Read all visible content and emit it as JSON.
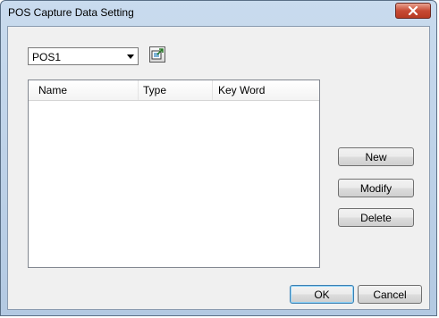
{
  "window": {
    "title": "POS Capture Data Setting"
  },
  "pos_select": {
    "value": "POS1"
  },
  "list": {
    "columns": [
      "Name",
      "Type",
      "Key Word"
    ],
    "rows": []
  },
  "side_buttons": {
    "new_label": "New",
    "modify_label": "Modify",
    "delete_label": "Delete"
  },
  "footer": {
    "ok_label": "OK",
    "cancel_label": "Cancel"
  },
  "icons": {
    "close": "close-icon",
    "export": "export-icon"
  }
}
